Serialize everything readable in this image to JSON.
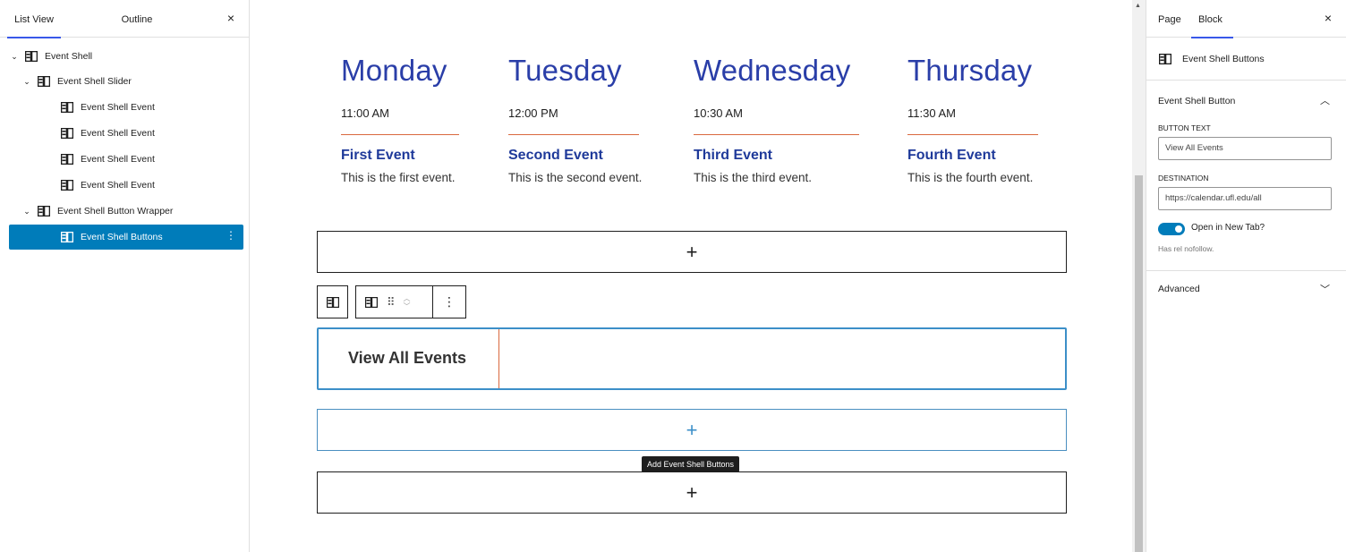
{
  "list_view": {
    "tabs": [
      "List View",
      "Outline"
    ],
    "close": "×",
    "items": [
      {
        "label": "Event Shell",
        "chevron": "⌄"
      },
      {
        "label": "Event Shell Slider",
        "chevron": "⌄"
      },
      {
        "label": "Event Shell Event"
      },
      {
        "label": "Event Shell Event"
      },
      {
        "label": "Event Shell Event"
      },
      {
        "label": "Event Shell Event"
      },
      {
        "label": "Event Shell Button Wrapper",
        "chevron": "⌄"
      },
      {
        "label": "Event Shell Buttons",
        "options": "⋮"
      }
    ]
  },
  "events": [
    {
      "day": "Monday",
      "time": "11:00 AM",
      "title": "First Event",
      "desc": "This is the first event."
    },
    {
      "day": "Tuesday",
      "time": "12:00 PM",
      "title": "Second Event",
      "desc": "This is the second event."
    },
    {
      "day": "Wednesday",
      "time": "10:30 AM",
      "title": "Third Event",
      "desc": "This is the third event."
    },
    {
      "day": "Thursday",
      "time": "11:30 AM",
      "title": "Fourth Event",
      "desc": "This is the fourth event."
    }
  ],
  "canvas": {
    "plus": "+",
    "button_text": "View All Events",
    "tooltip": "Add Event Shell Buttons",
    "options": "⋮"
  },
  "settings": {
    "tabs": [
      "Page",
      "Block"
    ],
    "close": "×",
    "block_name": "Event Shell Buttons",
    "section_title": "Event Shell Button",
    "button_text_label": "BUTTON TEXT",
    "button_text_value": "View All Events",
    "destination_label": "DESTINATION",
    "destination_value": "https://calendar.ufl.edu/all",
    "open_new_tab_label": "Open in New Tab?",
    "rel_help": "Has rel nofollow.",
    "advanced_label": "Advanced",
    "open_new_tab": true
  },
  "colors": {
    "accent": "#007cba",
    "day_blue": "#2a3ea8",
    "rule_orange": "#d9693f"
  }
}
